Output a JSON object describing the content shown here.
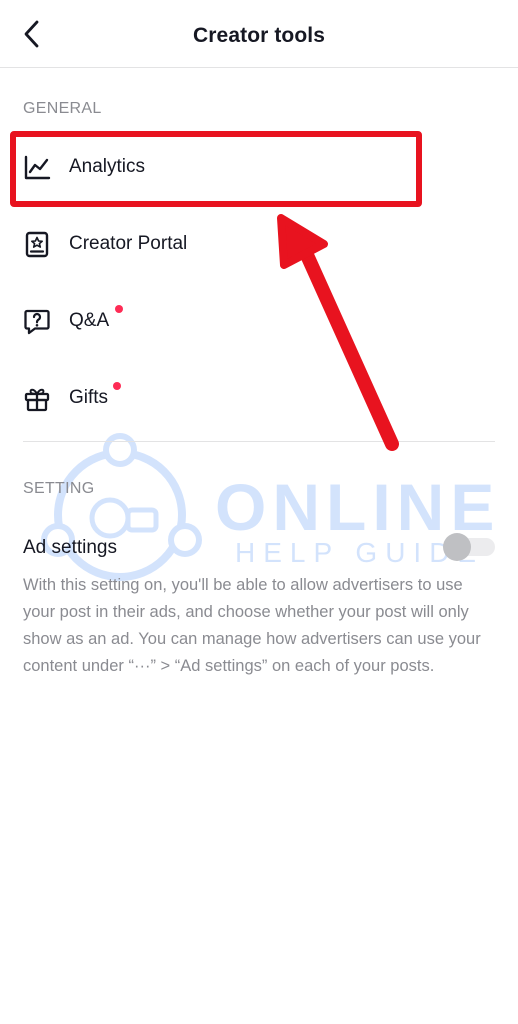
{
  "header": {
    "title": "Creator tools",
    "back_icon": "chevron-left-icon"
  },
  "sections": {
    "general": {
      "label": "GENERAL",
      "items": [
        {
          "label": "Analytics",
          "icon": "chart-line-icon",
          "has_dot": false
        },
        {
          "label": "Creator Portal",
          "icon": "portal-book-icon",
          "has_dot": false
        },
        {
          "label": "Q&A",
          "icon": "question-bubble-icon",
          "has_dot": true
        },
        {
          "label": "Gifts",
          "icon": "gift-icon",
          "has_dot": true
        }
      ]
    },
    "setting": {
      "label": "SETTING",
      "ad_settings": {
        "label": "Ad settings",
        "toggle_on": false,
        "description": "With this setting on, you'll be able to allow advertisers to use your post in their ads, and choose whether your post will only show as an ad. You can manage how advertisers can use your content under “···” > “Ad settings” on each of your posts."
      }
    }
  },
  "overlay": {
    "watermark_line1": "ONLINE",
    "watermark_line2": "HELP GUIDE"
  },
  "colors": {
    "notification_dot": "#fe2c55",
    "highlight_red": "#e8131f",
    "muted_text": "#8a8b91",
    "primary_text": "#161823"
  }
}
